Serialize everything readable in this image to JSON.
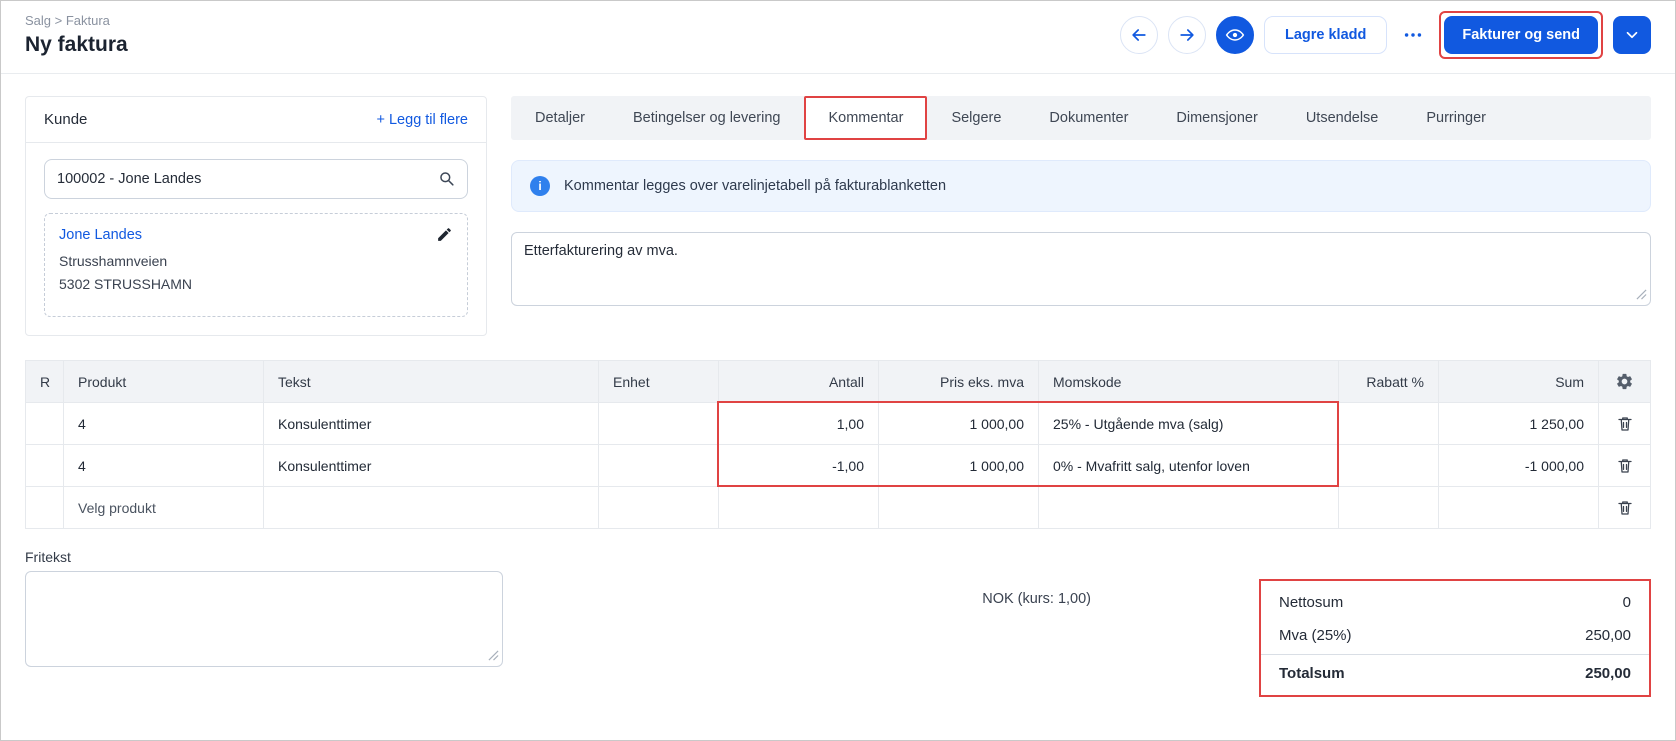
{
  "colors": {
    "blue": "#1159e0",
    "red": "#e04343"
  },
  "header": {
    "breadcrumb": "Salg > Faktura",
    "title": "Ny faktura",
    "save_draft_label": "Lagre kladd",
    "invoice_send_label": "Fakturer og send"
  },
  "customer": {
    "title": "Kunde",
    "add_more_label": "+ Legg til flere",
    "search_value": "100002 - Jone Landes",
    "name": "Jone Landes",
    "address_line1": "Strusshamnveien",
    "address_line2": "5302 STRUSSHAMN"
  },
  "tabs": [
    "Detaljer",
    "Betingelser og levering",
    "Kommentar",
    "Selgere",
    "Dokumenter",
    "Dimensjoner",
    "Utsendelse",
    "Purringer"
  ],
  "active_tab": "Kommentar",
  "info_banner": "Kommentar legges over varelinjetabell på fakturablanketten",
  "comment_value": "Etterfakturering av mva.",
  "table": {
    "headers": [
      "R",
      "Produkt",
      "Tekst",
      "Enhet",
      "Antall",
      "Pris eks. mva",
      "Momskode",
      "Rabatt %",
      "Sum"
    ],
    "rows": [
      {
        "r": "",
        "produkt": "4",
        "tekst": "Konsulenttimer",
        "enhet": "",
        "antall": "1,00",
        "pris": "1 000,00",
        "momskode": "25% - Utgående mva (salg)",
        "rabatt": "",
        "sum": "1 250,00"
      },
      {
        "r": "",
        "produkt": "4",
        "tekst": "Konsulenttimer",
        "enhet": "",
        "antall": "-1,00",
        "pris": "1 000,00",
        "momskode": "0% - Mvafritt salg, utenfor loven",
        "rabatt": "",
        "sum": "-1 000,00"
      }
    ],
    "new_row_placeholder": "Velg produkt"
  },
  "footer": {
    "fritekst_label": "Fritekst",
    "currency_label": "NOK (kurs: 1,00)",
    "totals": [
      {
        "label": "Nettosum",
        "value": "0"
      },
      {
        "label": "Mva (25%)",
        "value": "250,00"
      },
      {
        "label": "Totalsum",
        "value": "250,00"
      }
    ]
  }
}
